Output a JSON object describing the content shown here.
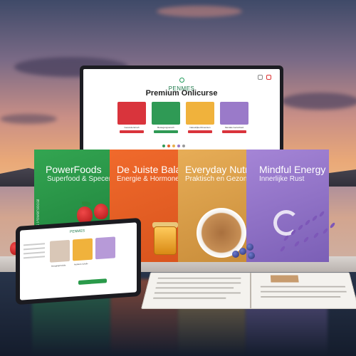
{
  "monitor": {
    "logo": "PENMES",
    "title": "Premium Onlicurse",
    "cards": [
      {
        "caption": "Gesunde Ernah",
        "color": "#d9343c",
        "button_color": "#d9343c"
      },
      {
        "caption": "Bewegungsonsch",
        "color": "#2f9a55",
        "button_color": "#2f9a55"
      },
      {
        "caption": "Natuurlijke Rimenisen",
        "color": "#f0b23c",
        "button_color": "#d9343c"
      },
      {
        "caption": "Mentale Gezonheid",
        "color": "#9a7ac9",
        "button_color": "#d9343c"
      }
    ],
    "carousel_dots": [
      "#2f9a55",
      "#e5602a",
      "#e8b04c",
      "#9a77c8",
      "#9a9a9a"
    ]
  },
  "products": [
    {
      "title": "PowerFoods",
      "subtitle": "Superfood & Specenj",
      "spine": "Power Foods PowerSocial",
      "color": "green"
    },
    {
      "title": "De Juiste Balans",
      "subtitle": "Energie & Hormonen",
      "spine": "",
      "color": "orange"
    },
    {
      "title": "Everyday Nutrition",
      "subtitle": "Praktisch en Gezond",
      "spine": "",
      "color": "gold"
    },
    {
      "title": "Mindful Energy",
      "subtitle": "Innerlijke Rust",
      "spine": "",
      "color": "purple"
    }
  ],
  "tablet": {
    "logo": "PENMES",
    "captions": [
      "Bewegingsmodule",
      "Nutritions Schelle"
    ]
  }
}
